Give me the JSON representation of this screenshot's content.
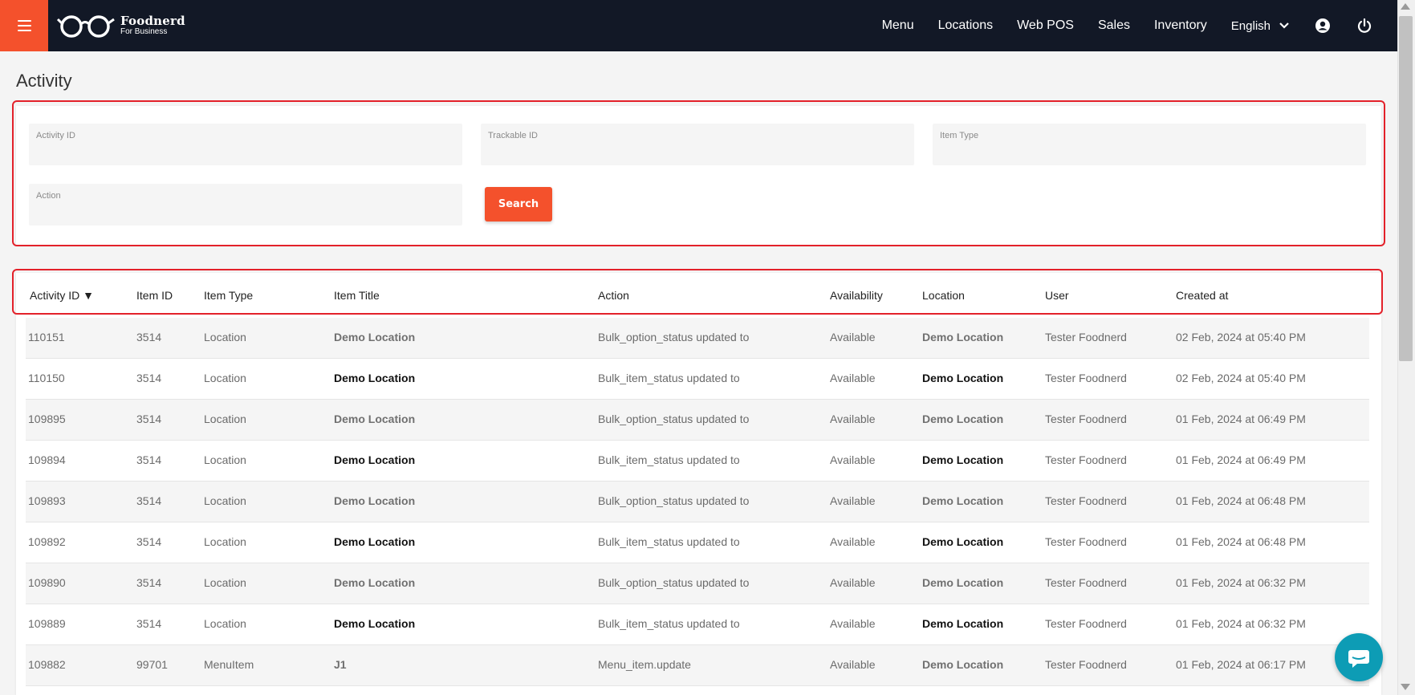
{
  "brand": {
    "name": "Foodnerd",
    "subtitle": "For Business"
  },
  "nav": {
    "items": [
      "Menu",
      "Locations",
      "Web POS",
      "Sales",
      "Inventory"
    ],
    "language": "English",
    "icons": [
      "hamburger-icon",
      "chevron-down-icon",
      "user-icon",
      "power-icon"
    ]
  },
  "colors": {
    "accent": "#f4512c",
    "topbar": "#121826",
    "highlight": "#e3212a",
    "chat": "#0d9cb5"
  },
  "page": {
    "title": "Activity"
  },
  "filters": {
    "activity_id_label": "Activity ID",
    "trackable_id_label": "Trackable ID",
    "item_type_label": "Item Type",
    "action_label": "Action",
    "search_label": "Search"
  },
  "table": {
    "headers": [
      "Activity ID ▼",
      "Item ID",
      "Item Type",
      "Item Title",
      "Action",
      "Availability",
      "Location",
      "User",
      "Created at"
    ],
    "rows": [
      [
        "110151",
        "3514",
        "Location",
        "Demo Location",
        "Bulk_option_status updated to",
        "Available",
        "Demo Location",
        "Tester Foodnerd",
        "02 Feb, 2024 at 05:40 PM"
      ],
      [
        "110150",
        "3514",
        "Location",
        "Demo Location",
        "Bulk_item_status updated to",
        "Available",
        "Demo Location",
        "Tester Foodnerd",
        "02 Feb, 2024 at 05:40 PM"
      ],
      [
        "109895",
        "3514",
        "Location",
        "Demo Location",
        "Bulk_option_status updated to",
        "Available",
        "Demo Location",
        "Tester Foodnerd",
        "01 Feb, 2024 at 06:49 PM"
      ],
      [
        "109894",
        "3514",
        "Location",
        "Demo Location",
        "Bulk_item_status updated to",
        "Available",
        "Demo Location",
        "Tester Foodnerd",
        "01 Feb, 2024 at 06:49 PM"
      ],
      [
        "109893",
        "3514",
        "Location",
        "Demo Location",
        "Bulk_option_status updated to",
        "Available",
        "Demo Location",
        "Tester Foodnerd",
        "01 Feb, 2024 at 06:48 PM"
      ],
      [
        "109892",
        "3514",
        "Location",
        "Demo Location",
        "Bulk_item_status updated to",
        "Available",
        "Demo Location",
        "Tester Foodnerd",
        "01 Feb, 2024 at 06:48 PM"
      ],
      [
        "109890",
        "3514",
        "Location",
        "Demo Location",
        "Bulk_option_status updated to",
        "Available",
        "Demo Location",
        "Tester Foodnerd",
        "01 Feb, 2024 at 06:32 PM"
      ],
      [
        "109889",
        "3514",
        "Location",
        "Demo Location",
        "Bulk_item_status updated to",
        "Available",
        "Demo Location",
        "Tester Foodnerd",
        "01 Feb, 2024 at 06:32 PM"
      ],
      [
        "109882",
        "99701",
        "MenuItem",
        "J1",
        "Menu_item.update",
        "Available",
        "Demo Location",
        "Tester Foodnerd",
        "01 Feb, 2024 at 06:17 PM"
      ]
    ]
  }
}
